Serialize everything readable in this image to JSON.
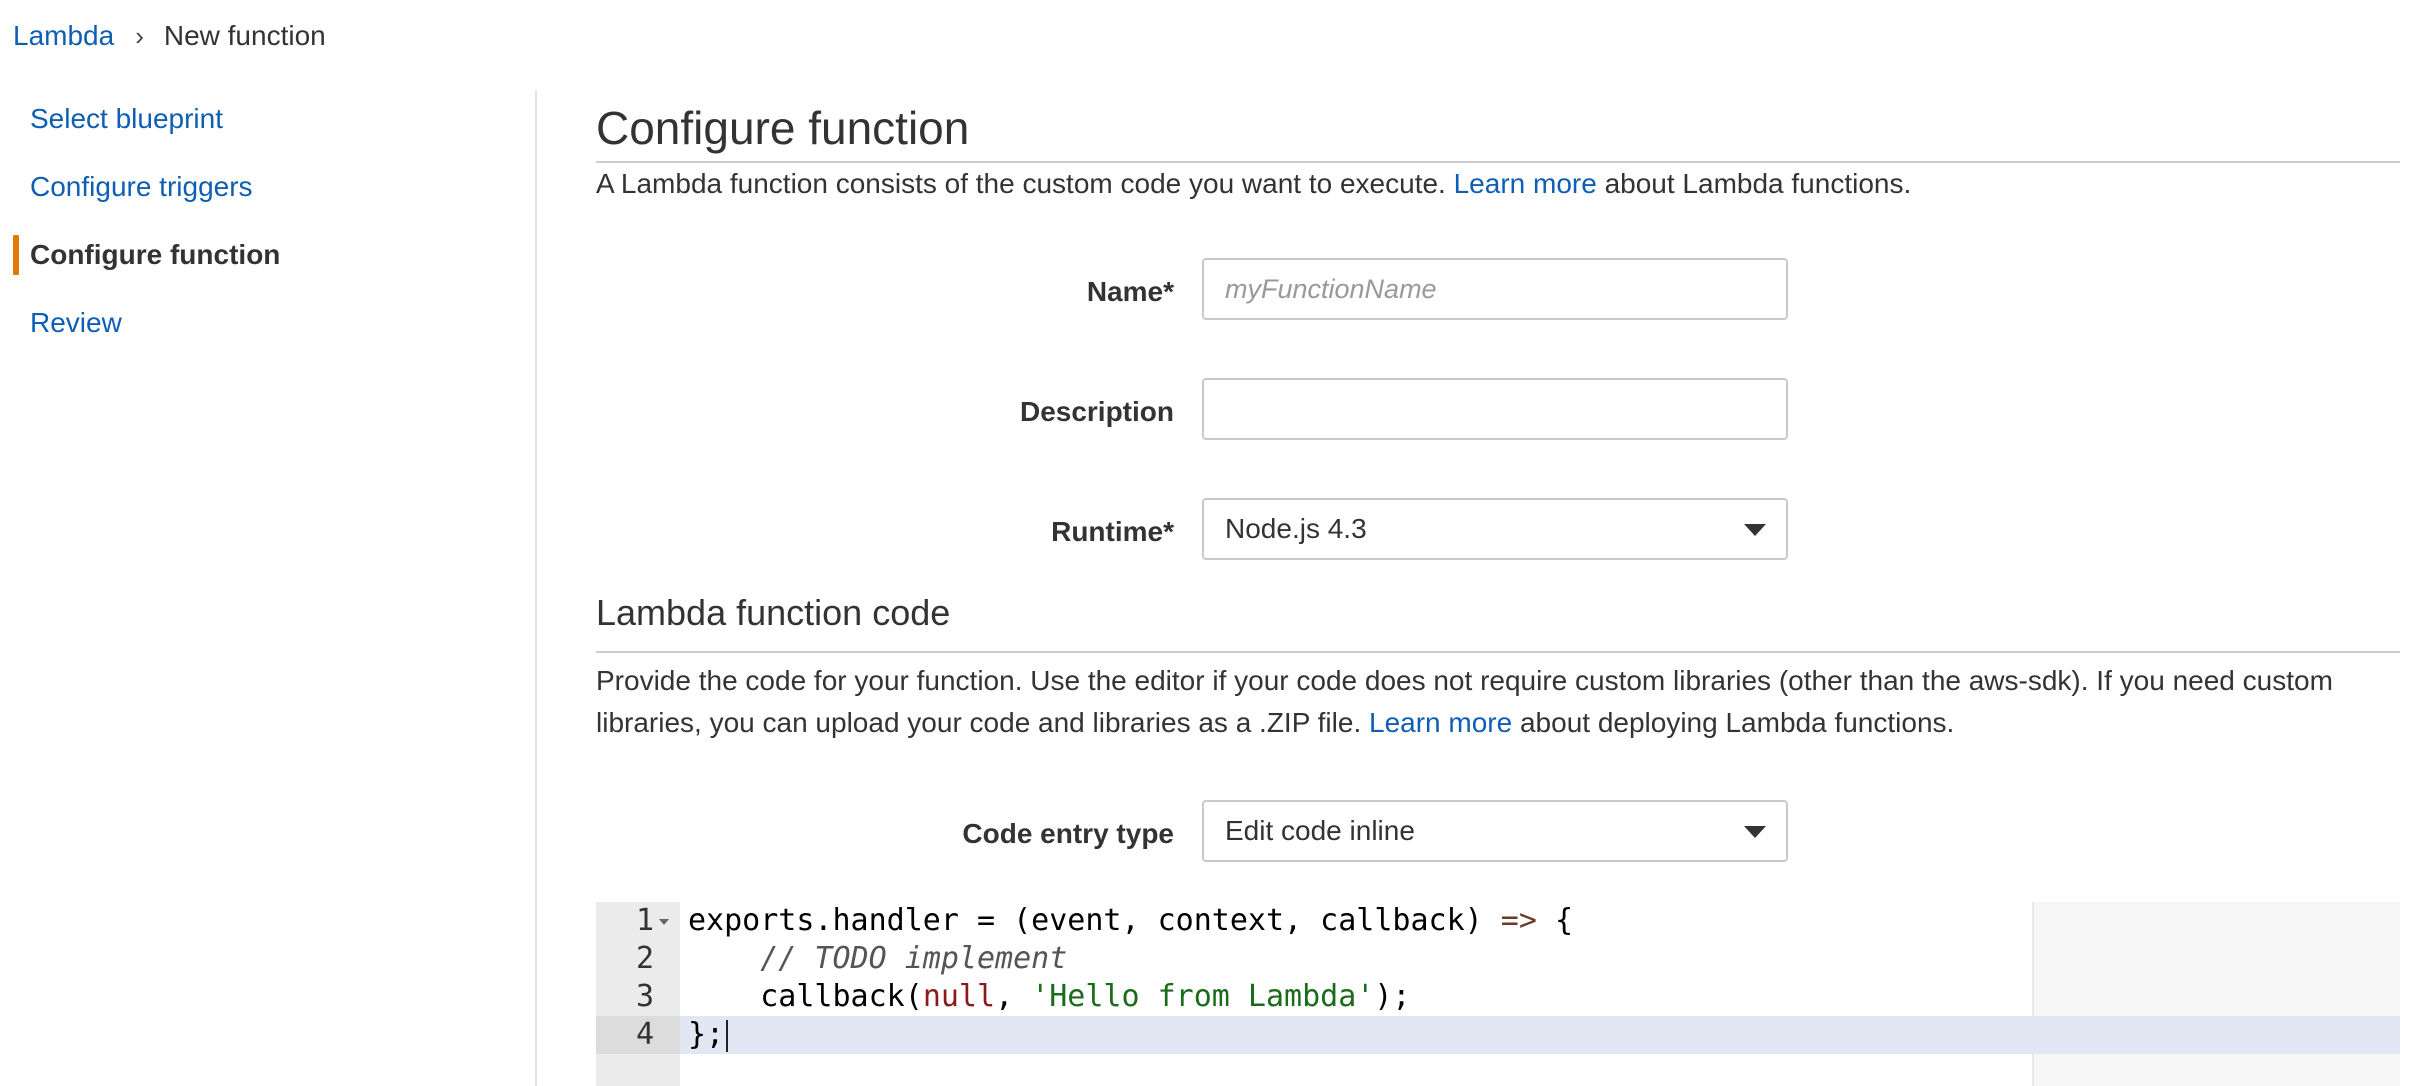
{
  "breadcrumb": {
    "root": "Lambda",
    "separator": "›",
    "current": "New function"
  },
  "sidebar": {
    "items": [
      {
        "label": "Select blueprint",
        "active": false
      },
      {
        "label": "Configure triggers",
        "active": false
      },
      {
        "label": "Configure function",
        "active": true
      },
      {
        "label": "Review",
        "active": false
      }
    ],
    "active_color": "#e07b00"
  },
  "main": {
    "title": "Configure function",
    "intro": {
      "pre": "A Lambda function consists of the custom code you want to execute. ",
      "link": "Learn more",
      "post": " about Lambda functions."
    },
    "form": {
      "name": {
        "label": "Name*",
        "value": "",
        "placeholder": "myFunctionName"
      },
      "description": {
        "label": "Description",
        "value": "",
        "placeholder": ""
      },
      "runtime": {
        "label": "Runtime*",
        "selected": "Node.js 4.3"
      }
    },
    "code_section": {
      "title": "Lambda function code",
      "desc": {
        "pre": "Provide the code for your function. Use the editor if your code does not require custom libraries (other than the aws-sdk). If you need custom libraries, you can upload your code and libraries as a .ZIP file. ",
        "link": "Learn more",
        "post": " about deploying Lambda functions."
      },
      "code_entry_type": {
        "label": "Code entry type",
        "selected": "Edit code inline"
      }
    },
    "editor": {
      "line_numbers": [
        "1",
        "2",
        "3",
        "4"
      ],
      "active_line": 4,
      "lines": [
        [
          {
            "t": "exports.handler = (event, context, callback) ",
            "c": "plain"
          },
          {
            "t": "=>",
            "c": "kw-op"
          },
          {
            "t": " {",
            "c": "plain"
          }
        ],
        [
          {
            "t": "    ",
            "c": "plain"
          },
          {
            "t": "// TODO implement",
            "c": "comment"
          }
        ],
        [
          {
            "t": "    callback(",
            "c": "plain"
          },
          {
            "t": "null",
            "c": "null"
          },
          {
            "t": ", ",
            "c": "plain"
          },
          {
            "t": "'Hello from Lambda'",
            "c": "str"
          },
          {
            "t": ");",
            "c": "plain"
          }
        ],
        [
          {
            "t": "};",
            "c": "plain"
          }
        ]
      ]
    }
  },
  "colors": {
    "link": "#0f5eb5",
    "accent": "#e07b00"
  }
}
